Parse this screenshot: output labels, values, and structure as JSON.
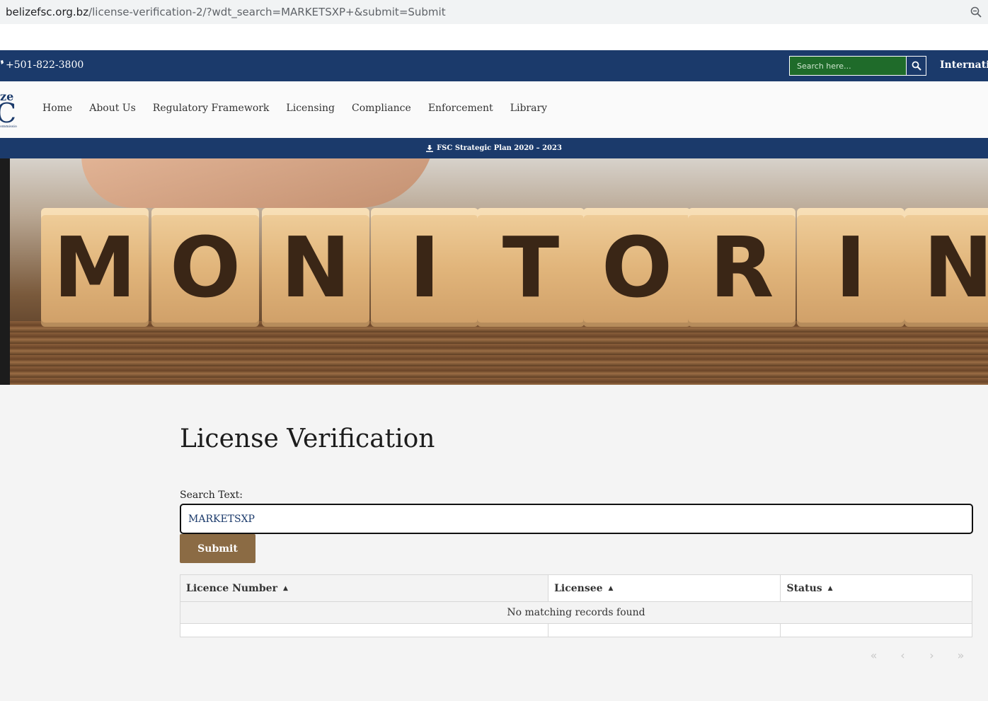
{
  "browser": {
    "domain": "belizefsc.org.bz",
    "path": "/license-verification-2/?wdt_search=MARKETSXP+&submit=Submit"
  },
  "topbar": {
    "phone": "+501-822-3800",
    "search_placeholder": "Search here...",
    "international": "International"
  },
  "logo": {
    "line1": "ze",
    "line2": "C",
    "line3": "ommission"
  },
  "nav": {
    "items": [
      "Home",
      "About Us",
      "Regulatory Framework",
      "Licensing",
      "Compliance",
      "Enforcement",
      "Library"
    ]
  },
  "strip": {
    "label": "FSC Strategic Plan 2020 – 2023"
  },
  "hero": {
    "letters": [
      "M",
      "O",
      "N",
      "I",
      "T",
      "O",
      "R",
      "I",
      "N"
    ]
  },
  "main": {
    "title": "License Verification",
    "search_label": "Search Text:",
    "search_value": "MARKETSXP",
    "submit_label": "Submit"
  },
  "table": {
    "columns": [
      "Licence Number",
      "Licensee",
      "Status"
    ],
    "empty_message": "No matching records found"
  },
  "pager": {
    "first": "«",
    "prev": "‹",
    "next": "›",
    "last": "»"
  },
  "colors": {
    "navy": "#1b3a6b",
    "search_green": "#1f6b2a",
    "submit_brown": "#8b6b44"
  }
}
